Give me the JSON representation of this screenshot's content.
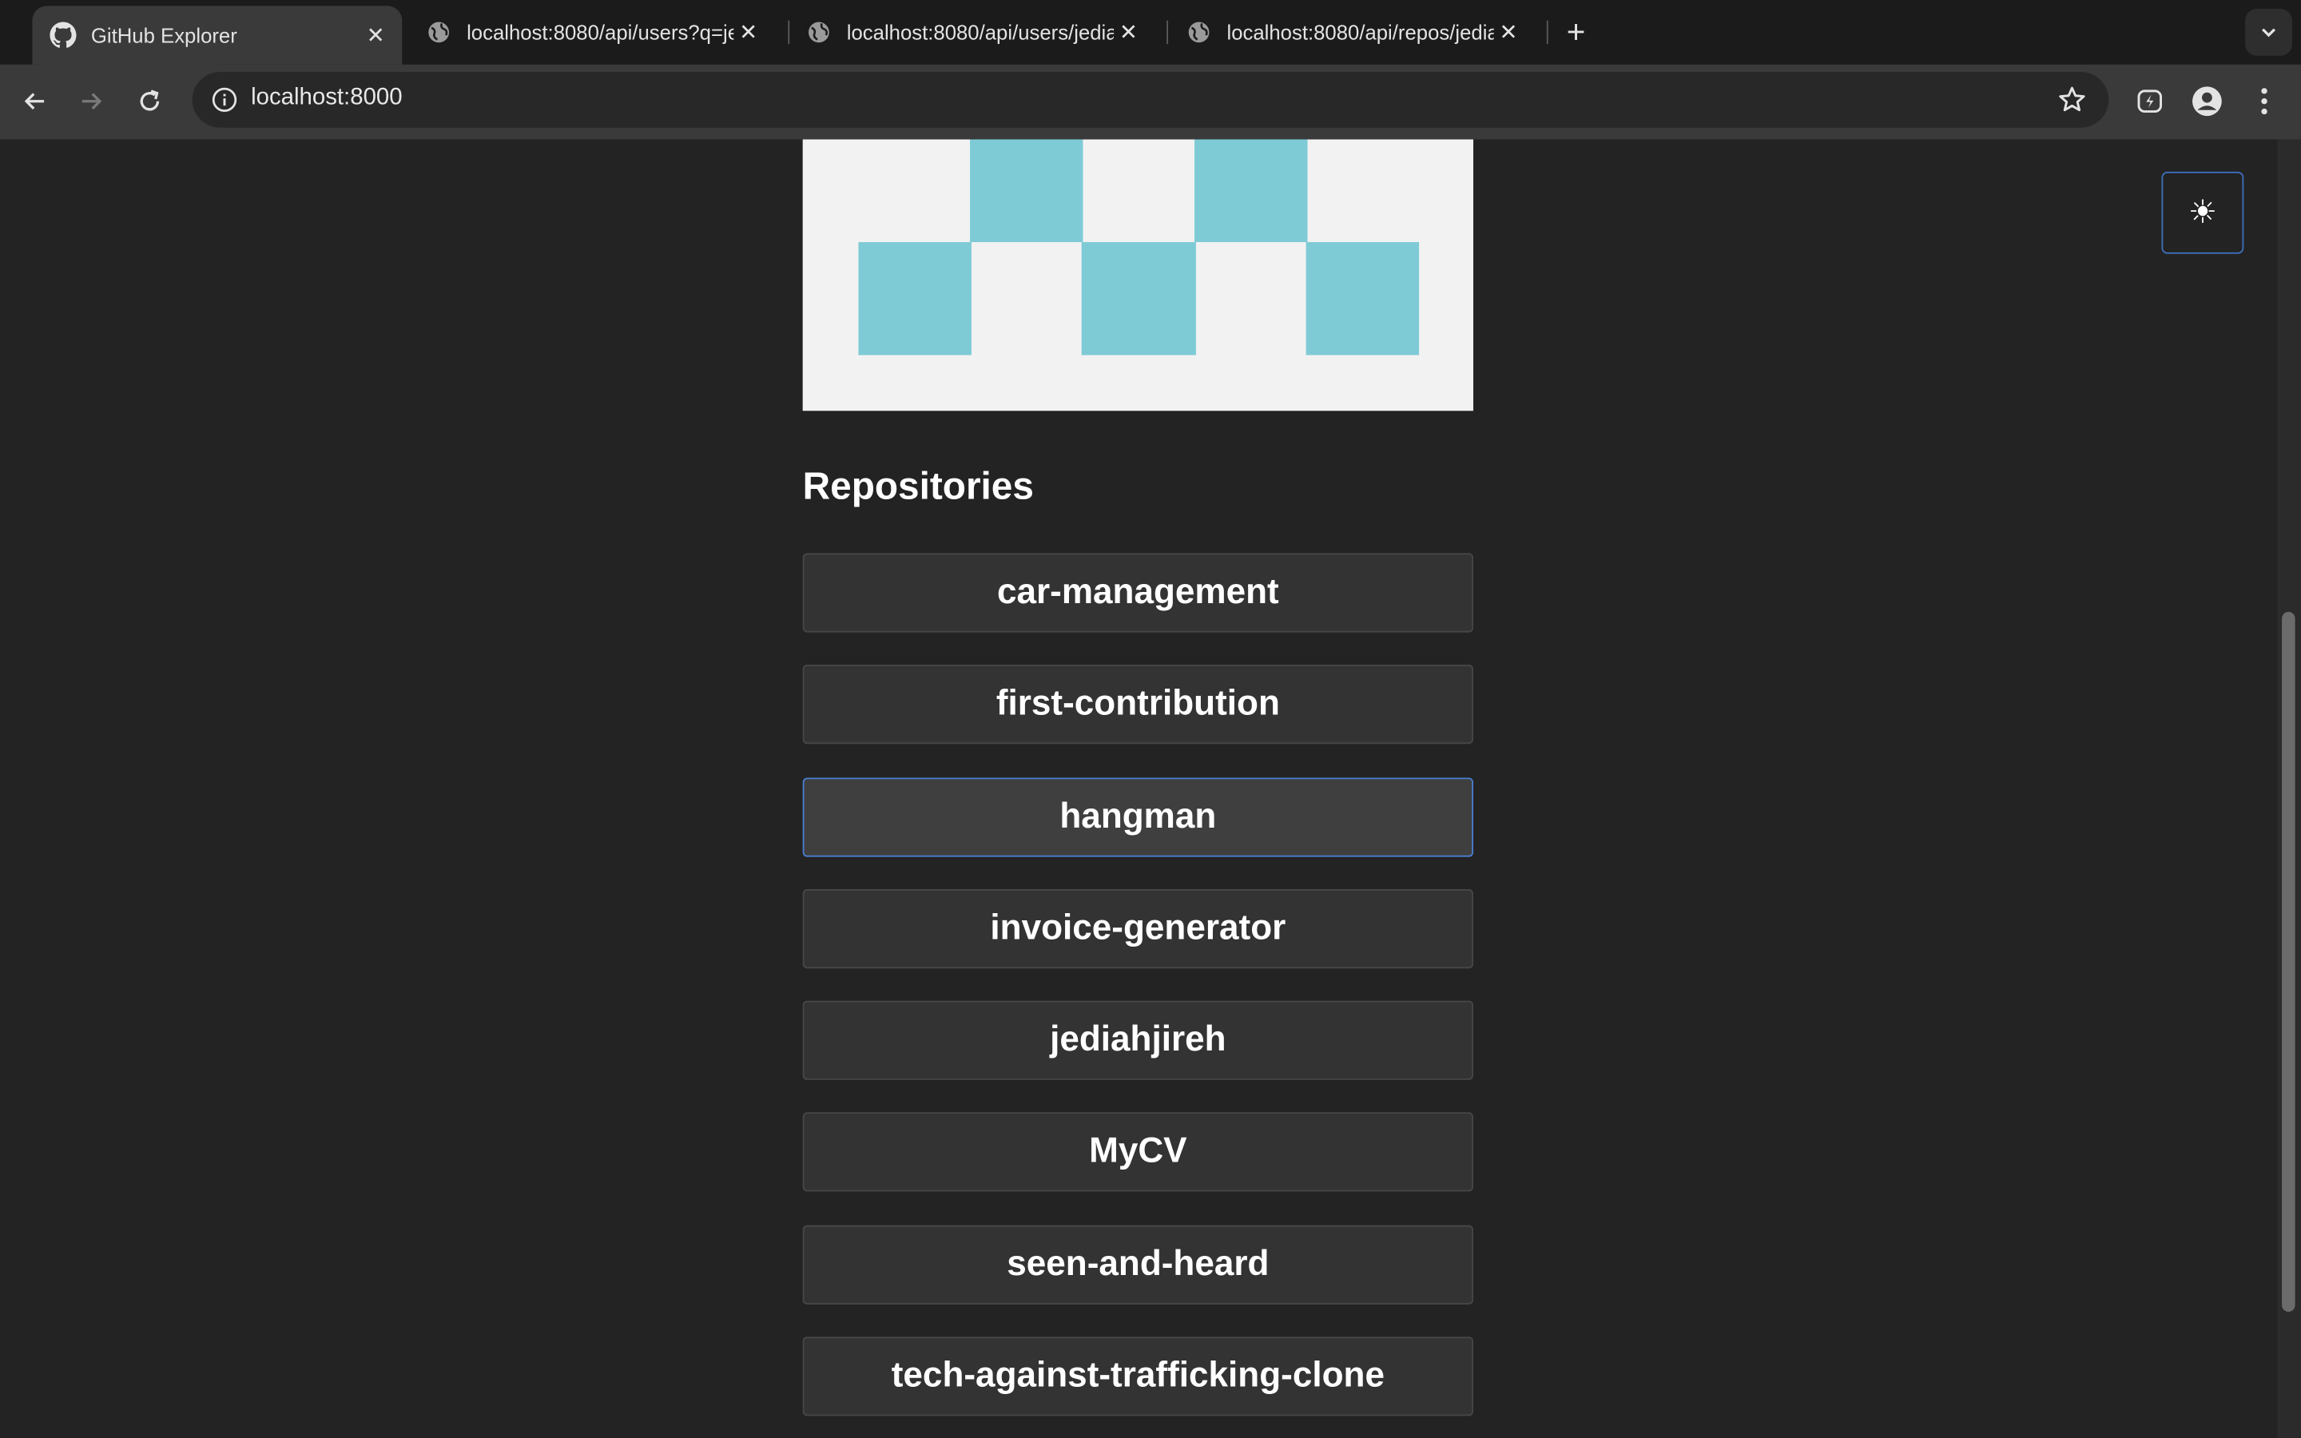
{
  "browser": {
    "tabs": [
      {
        "title": "GitHub Explorer",
        "active": true,
        "icon": "github-icon"
      },
      {
        "title": "localhost:8080/api/users?q=je",
        "active": false,
        "icon": "globe-icon"
      },
      {
        "title": "localhost:8080/api/users/jedia",
        "active": false,
        "icon": "globe-icon"
      },
      {
        "title": "localhost:8080/api/repos/jedia",
        "active": false,
        "icon": "globe-icon"
      }
    ],
    "address": "localhost:8000"
  },
  "page": {
    "theme_toggle_icon": "☀",
    "avatar_color": "#7ecbd6",
    "repositories_heading": "Repositories",
    "repositories": [
      {
        "name": "car-management"
      },
      {
        "name": "first-contribution"
      },
      {
        "name": "hangman",
        "focused": true
      },
      {
        "name": "invoice-generator"
      },
      {
        "name": "jediahjireh"
      },
      {
        "name": "MyCV"
      },
      {
        "name": "seen-and-heard"
      },
      {
        "name": "tech-against-trafficking-clone"
      }
    ]
  }
}
